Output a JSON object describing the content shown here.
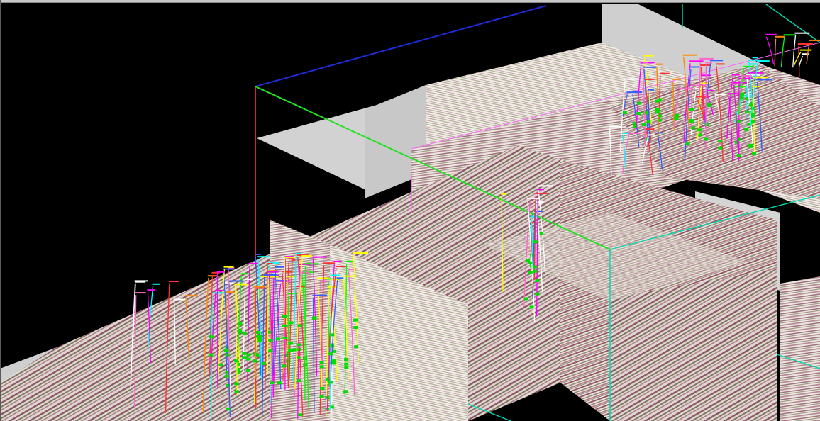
{
  "viewer": {
    "background_color": "#000000",
    "seismic_colors": {
      "peak": "#6b1f3a",
      "trough": "#4a3a20",
      "base": "#e8e4dc"
    },
    "axis_colors": {
      "x": "#ff0000",
      "y": "#00ff00",
      "z": "#0000ff",
      "bbox": "#00e0b0"
    },
    "well_colors": [
      "#ff00ff",
      "#00ffff",
      "#ffff00",
      "#00ff00",
      "#ff3030",
      "#ffffff",
      "#3060ff",
      "#ff8800",
      "#ff66cc"
    ],
    "marker_color": "#00dd00"
  }
}
